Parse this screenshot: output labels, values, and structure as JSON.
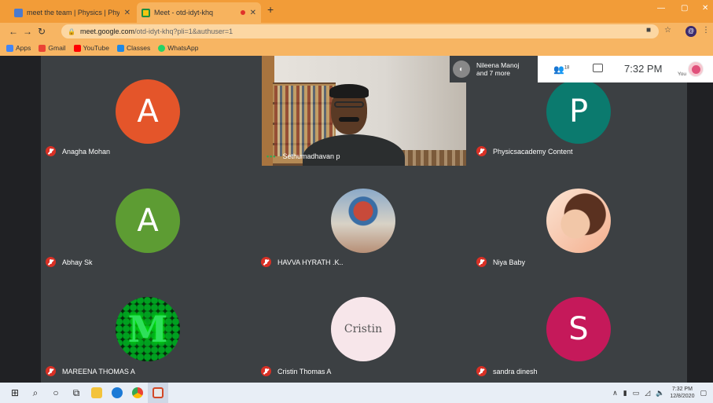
{
  "browser": {
    "tabs": [
      {
        "title": "meet the team | Physics | Physi",
        "active": false
      },
      {
        "title": "Meet - otd-idyt-khq",
        "active": true
      }
    ],
    "new_tab": "+",
    "window_controls": {
      "minimize": "—",
      "maximize": "▢",
      "close": "✕"
    },
    "url_host": "meet.google.com",
    "url_path": "/otd-idyt-khq?pli=1&authuser=1",
    "profile_initial": "@",
    "bookmarks": [
      {
        "label": "Apps",
        "color": "#4285f4"
      },
      {
        "label": "Gmail",
        "color": "#ea4335"
      },
      {
        "label": "YouTube",
        "color": "#ff0000"
      },
      {
        "label": "Classes",
        "color": "#1e88e5"
      },
      {
        "label": "WhatsApp",
        "color": "#25d366"
      }
    ]
  },
  "meet": {
    "others_label_line1": "Nileena Manoj",
    "others_label_line2": "and 7 more",
    "people_count": "18",
    "clock": "7:32 PM",
    "you_label": "You",
    "speaker": {
      "name": "Sethumadhavan p"
    },
    "participants": [
      {
        "name": "Anagha Mohan",
        "initial": "A",
        "color": "#e4552a"
      },
      {
        "name": "Physicsacademy Content",
        "initial": "P",
        "color": "#0b7a6e"
      },
      {
        "name": "Abhay Sk",
        "initial": "A",
        "color": "#5d9c33"
      },
      {
        "name": "HAVVA HYRATH .K..",
        "initial": "",
        "color": ""
      },
      {
        "name": "Niya Baby",
        "initial": "",
        "color": ""
      },
      {
        "name": "MAREENA THOMAS A",
        "initial": "M",
        "color": ""
      },
      {
        "name": "Cristin Thomas A",
        "initial": "Cristin",
        "color": "#f7e6ea"
      },
      {
        "name": "sandra dinesh",
        "initial": "S",
        "color": "#c5195a"
      }
    ]
  },
  "taskbar": {
    "time": "7:32 PM",
    "date": "12/8/2020"
  }
}
